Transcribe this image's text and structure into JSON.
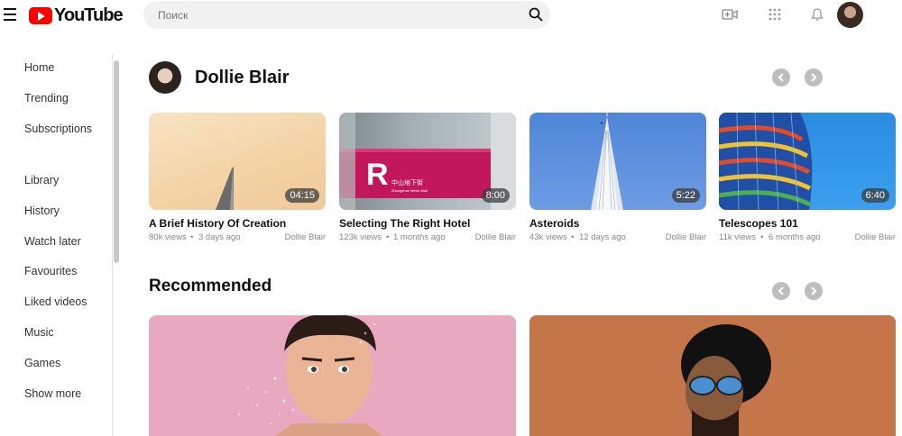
{
  "header": {
    "logo_text": "YouTube",
    "search_placeholder": "Поиск"
  },
  "sidebar": {
    "items": [
      {
        "label": "Home"
      },
      {
        "label": "Trending"
      },
      {
        "label": "Subscriptions"
      },
      {
        "label": "Library"
      },
      {
        "label": "History"
      },
      {
        "label": "Watch later"
      },
      {
        "label": "Favourites"
      },
      {
        "label": "Liked videos"
      },
      {
        "label": "Music"
      },
      {
        "label": "Games"
      },
      {
        "label": "Show more"
      }
    ]
  },
  "channel": {
    "name": "Dollie Blair",
    "videos": [
      {
        "title": "A Brief History Of Creation",
        "views": "80k views",
        "age": "3 days ago",
        "author": "Dollie Blair",
        "duration": "04:15"
      },
      {
        "title": "Selecting The Right Hotel",
        "views": "123k views",
        "age": "1 months ago",
        "author": "Dollie Blair",
        "duration": "8:00"
      },
      {
        "title": "Asteroids",
        "views": "43k views",
        "age": "12 days ago",
        "author": "Dollie Blair",
        "duration": "5:22"
      },
      {
        "title": "Telescopes 101",
        "views": "11k views",
        "age": "6 months ago",
        "author": "Dollie Blair",
        "duration": "6:40"
      }
    ]
  },
  "recommended": {
    "title": "Recommended"
  },
  "sign_text": {
    "line1": "中山地下街",
    "line2": "Zhongshan Metro Mall"
  }
}
